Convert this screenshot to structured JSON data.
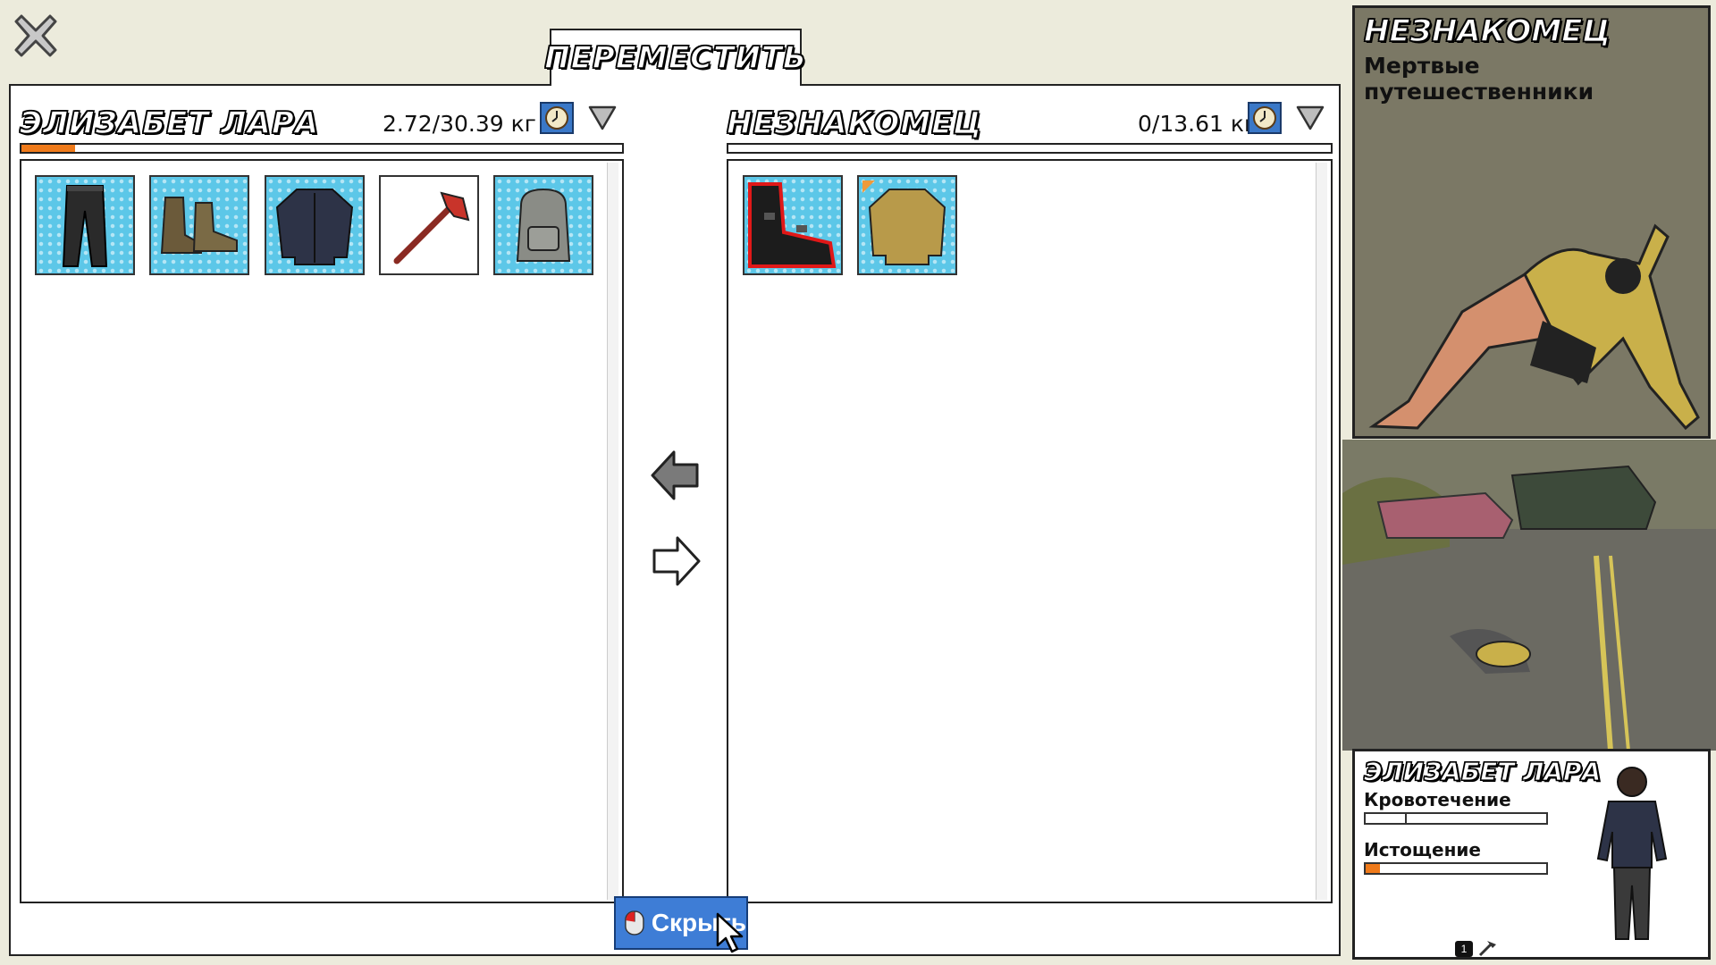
{
  "move_tab": {
    "label": "ПЕРЕМЕСТИТЬ"
  },
  "player_inventory": {
    "name": "ЭЛИЗАБЕТ ЛАРА",
    "weight": "2.72/30.39 кг",
    "weight_fill": 0.09,
    "items": [
      {
        "icon": "pants-icon",
        "style": "blue"
      },
      {
        "icon": "boots-icon",
        "style": "blue"
      },
      {
        "icon": "jacket-icon",
        "style": "blue"
      },
      {
        "icon": "axe-icon",
        "style": "plain"
      },
      {
        "icon": "backpack-icon",
        "style": "blue"
      }
    ]
  },
  "container_inventory": {
    "name": "НЕЗНАКОМЕЦ",
    "weight": "0/13.61 кг",
    "weight_fill": 0,
    "items": [
      {
        "icon": "black-boots-icon",
        "style": "blue",
        "damaged": true
      },
      {
        "icon": "yellow-sweater-icon",
        "style": "blue"
      }
    ]
  },
  "hide_button": {
    "label": "Скрыть"
  },
  "stranger_card": {
    "title": "НЕЗНАКОМЕЦ",
    "subtitle": "Мертвые путешественники"
  },
  "character_card": {
    "name": "ЭЛИЗАБЕТ ЛАРА",
    "stats": [
      {
        "label": "Кровотечение",
        "value": 0.22,
        "color": "#ffffff"
      },
      {
        "label": "Истощение",
        "value": 0.08,
        "color": "#ef7a1a"
      }
    ],
    "level": "1"
  },
  "colors": {
    "accent_orange": "#ef7a1a",
    "slot_blue": "#5cc7e8",
    "button_blue": "#3e7dd6"
  }
}
